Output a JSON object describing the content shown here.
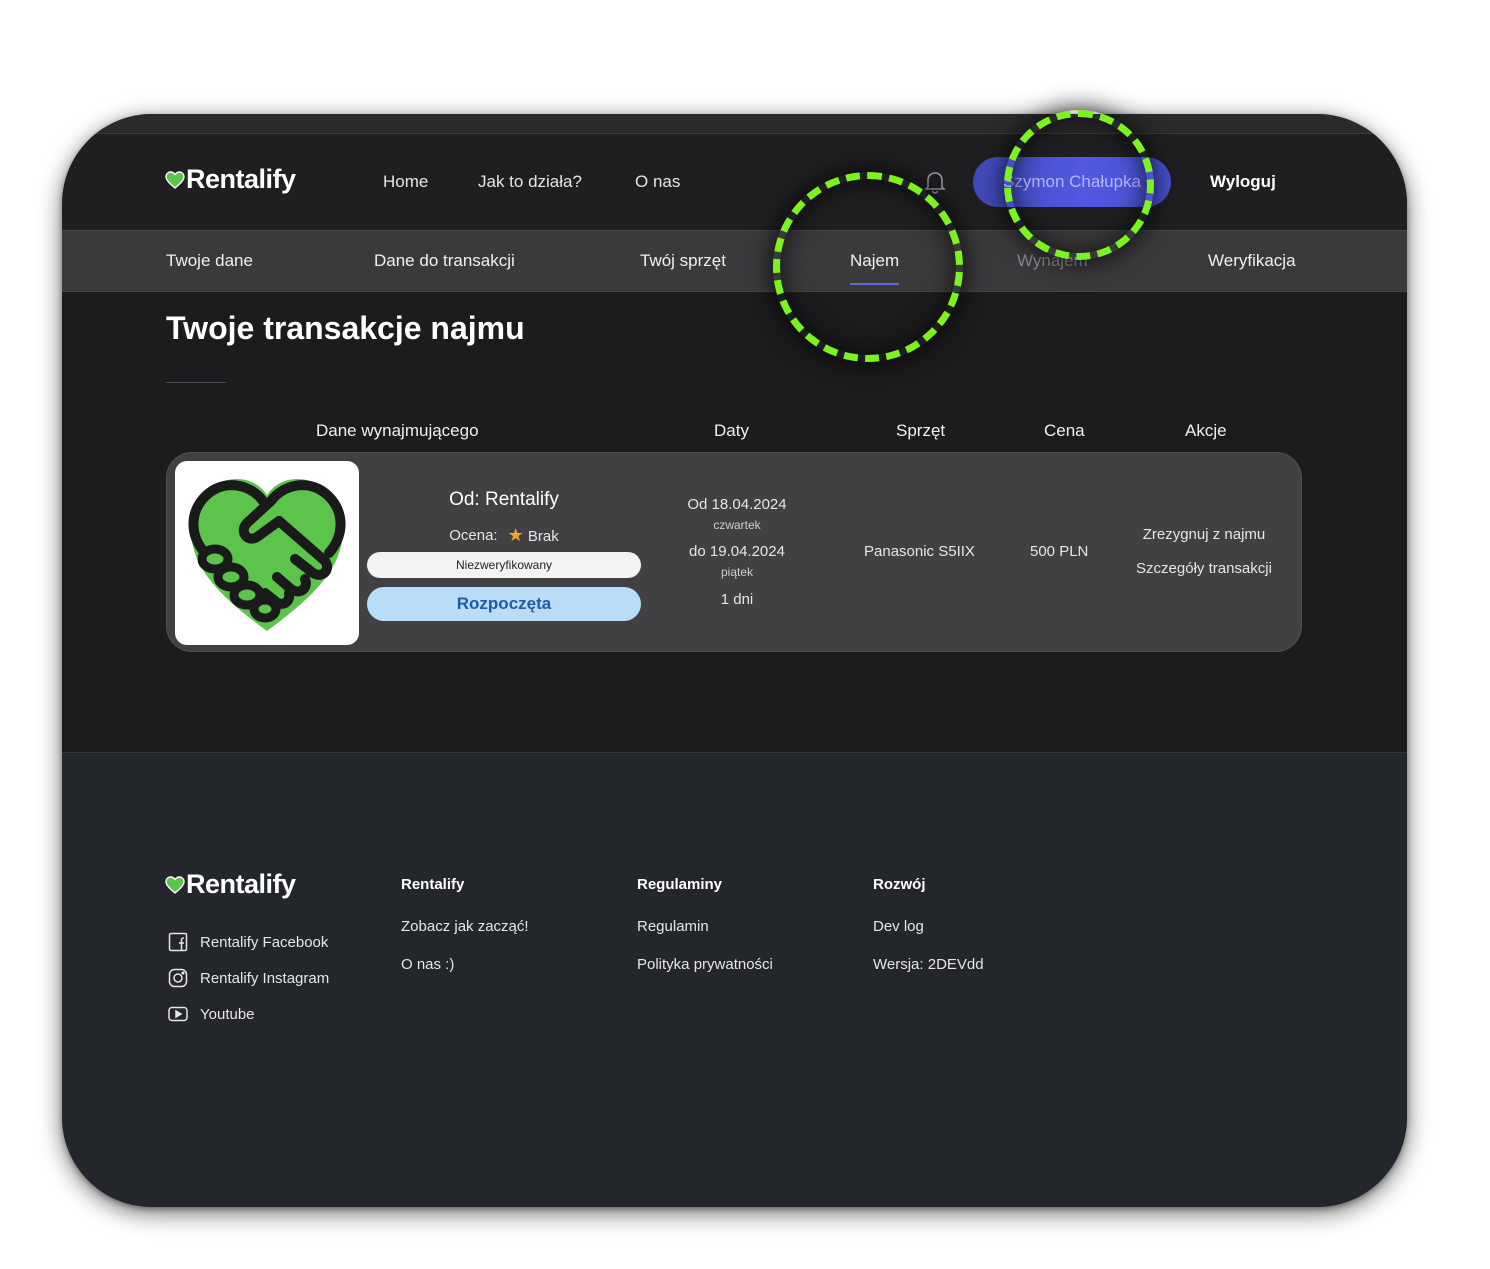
{
  "header": {
    "logo": "Rentalify",
    "nav": [
      "Home",
      "Jak to działa?",
      "O nas"
    ],
    "user_name": "Szymon Chałupka",
    "logout": "Wyloguj"
  },
  "tabs": [
    "Twoje dane",
    "Dane do transakcji",
    "Twój sprzęt",
    "Najem",
    "Wynajem",
    "Weryfikacja"
  ],
  "active_tab": "Najem",
  "page": {
    "title": "Twoje transakcje najmu",
    "columns": [
      "Dane wynajmującego",
      "Daty",
      "Sprzęt",
      "Cena",
      "Akcje"
    ]
  },
  "transaction": {
    "from": "Od: Rentalify",
    "rating_label": "Ocena:",
    "rating_value": "Brak",
    "verification": "Niezweryfikowany",
    "status": "Rozpoczęta",
    "date_from": "Od 18.04.2024",
    "day_from": "czwartek",
    "date_to": "do 19.04.2024",
    "day_to": "piątek",
    "duration": "1 dni",
    "equipment": "Panasonic S5IIX",
    "price": "500 PLN",
    "actions": [
      "Zrezygnuj z najmu",
      "Szczegóły transakcji"
    ]
  },
  "footer": {
    "logo": "Rentalify",
    "social": [
      "Rentalify Facebook",
      "Rentalify Instagram",
      "Youtube"
    ],
    "columns": [
      {
        "title": "Rentalify",
        "links": [
          "Zobacz jak zacząć!",
          "O nas :)"
        ]
      },
      {
        "title": "Regulaminy",
        "links": [
          "Regulamin",
          "Polityka prywatności"
        ]
      },
      {
        "title": "Rozwój",
        "links": [
          "Dev log",
          "Wersja: 2DEVdd"
        ]
      }
    ]
  },
  "colors": {
    "accent": "#5258e0",
    "highlight_ring": "#7cf21e",
    "status_bg": "#b9dcf7",
    "status_text": "#1e5ca8",
    "logo_green": "#5cc44a"
  }
}
